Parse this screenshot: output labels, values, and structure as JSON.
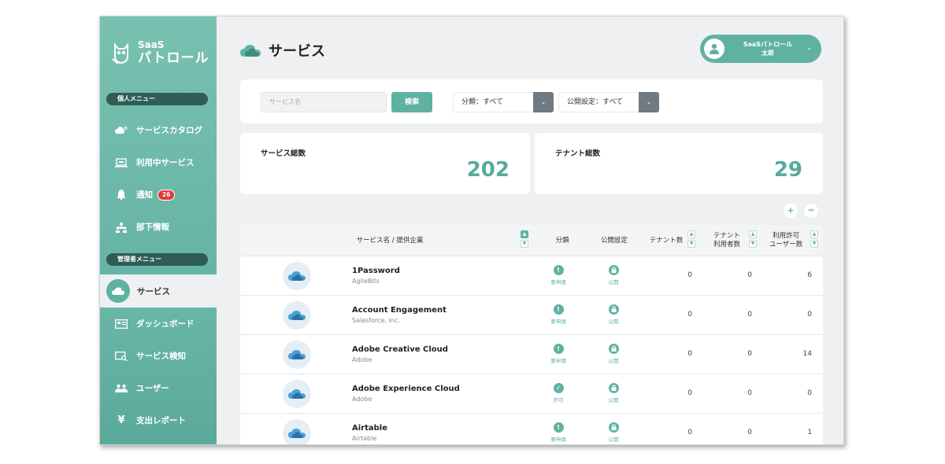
{
  "brand": {
    "line1": "SaaS",
    "line2": "パトロール"
  },
  "sidebar": {
    "personal_section": "個人メニュー",
    "personal_items": [
      {
        "label": "サービスカタログ",
        "icon": "cloud-user-icon"
      },
      {
        "label": "利用中サービス",
        "icon": "laptop-icon"
      },
      {
        "label": "通知",
        "icon": "bell-icon",
        "badge": "26"
      },
      {
        "label": "部下情報",
        "icon": "team-icon"
      }
    ],
    "admin_section": "管理者メニュー",
    "admin_active": {
      "label": "サービス",
      "icon": "cloud-icon"
    },
    "admin_items": [
      {
        "label": "ダッシュボード",
        "icon": "dashboard-icon"
      },
      {
        "label": "サービス検知",
        "icon": "search-window-icon"
      },
      {
        "label": "ユーザー",
        "icon": "users-icon"
      },
      {
        "label": "支出レポート",
        "icon": "yen-icon"
      }
    ]
  },
  "header": {
    "title": "サービス",
    "user": {
      "line1": "SaaSパトロール",
      "line2": "太郎"
    }
  },
  "search": {
    "placeholder": "サービス名",
    "button": "検索",
    "category_select": "分類：すべて",
    "public_select": "公開設定：すべて"
  },
  "stats": {
    "services_label": "サービス総数",
    "services_value": "202",
    "tenants_label": "テナント総数",
    "tenants_value": "29"
  },
  "actions": {
    "add": "+",
    "export": "⇨"
  },
  "table": {
    "headers": {
      "name": "サービス名 / 提供企業",
      "category": "分類",
      "public": "公開設定",
      "tenants": "テナント数",
      "tenant_users": "テナント\n利用者数",
      "licensed": "利用許可\nユーザー数"
    },
    "rows": [
      {
        "name": "1Password",
        "vendor": "AgileBits",
        "category": "要申請",
        "category_icon": "!",
        "public": "公開",
        "tenants": "0",
        "tenant_users": "0",
        "licensed": "6"
      },
      {
        "name": "Account Engagement",
        "vendor": "Salesforce, Inc.",
        "category": "要申請",
        "category_icon": "!",
        "public": "公開",
        "tenants": "0",
        "tenant_users": "0",
        "licensed": "0"
      },
      {
        "name": "Adobe Creative Cloud",
        "vendor": "Adobe",
        "category": "要申請",
        "category_icon": "!",
        "public": "公開",
        "tenants": "0",
        "tenant_users": "0",
        "licensed": "14"
      },
      {
        "name": "Adobe Experience Cloud",
        "vendor": "Adobe",
        "category": "許可",
        "category_icon": "✓",
        "public": "公開",
        "tenants": "0",
        "tenant_users": "0",
        "licensed": "0"
      },
      {
        "name": "Airtable",
        "vendor": "Airtable",
        "category": "要申請",
        "category_icon": "!",
        "public": "公開",
        "tenants": "0",
        "tenant_users": "0",
        "licensed": "1"
      }
    ]
  },
  "colors": {
    "accent": "#5fb2a2",
    "dark_pill": "#2f5d56",
    "badge": "#e53935"
  }
}
